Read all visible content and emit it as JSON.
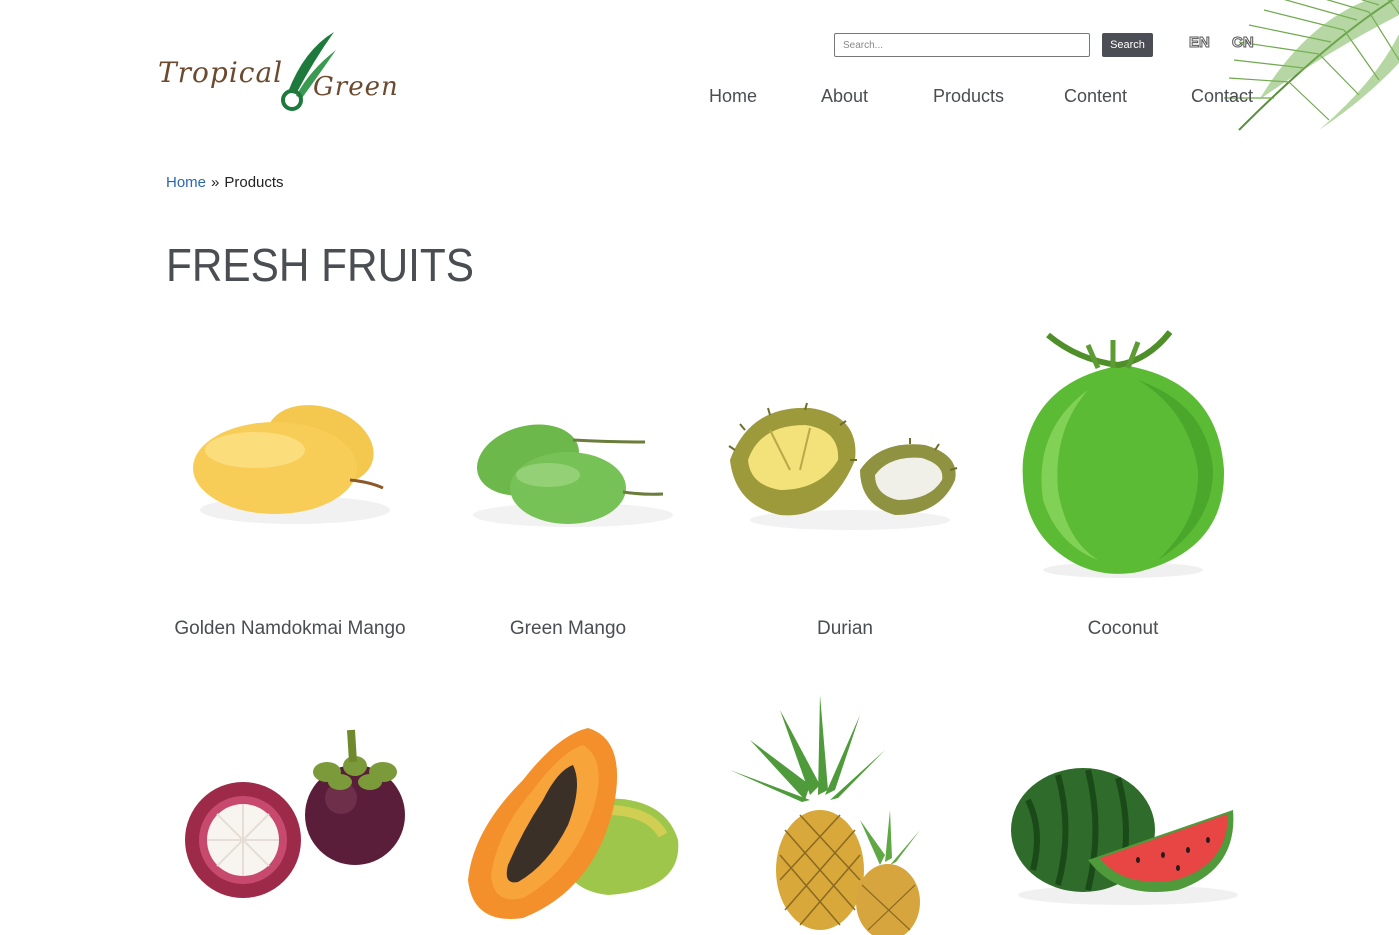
{
  "brand": {
    "word1": "Tropical",
    "word2": "Green"
  },
  "search": {
    "placeholder": "Search...",
    "button_label": "Search"
  },
  "languages": [
    "EN",
    "CN"
  ],
  "nav": [
    {
      "label": "Home"
    },
    {
      "label": "About"
    },
    {
      "label": "Products"
    },
    {
      "label": "Content"
    },
    {
      "label": "Contact"
    }
  ],
  "breadcrumb": {
    "home": "Home",
    "separator": "»",
    "current": "Products"
  },
  "page_title": "FRESH FRUITS",
  "products": [
    {
      "name": "Golden Namdokmai Mango",
      "icon": "golden-mango-image"
    },
    {
      "name": "Green Mango",
      "icon": "green-mango-image"
    },
    {
      "name": "Durian",
      "icon": "durian-image"
    },
    {
      "name": "Coconut",
      "icon": "coconut-image"
    },
    {
      "name": "",
      "icon": "mangosteen-image"
    },
    {
      "name": "",
      "icon": "papaya-image"
    },
    {
      "name": "",
      "icon": "pineapple-image"
    },
    {
      "name": "",
      "icon": "watermelon-image"
    }
  ],
  "colors": {
    "text": "#4a4d52",
    "link": "#2a67b1",
    "button": "#4b4f55",
    "logo_brown": "#6b4a2f",
    "logo_green": "#1e7a3c"
  }
}
